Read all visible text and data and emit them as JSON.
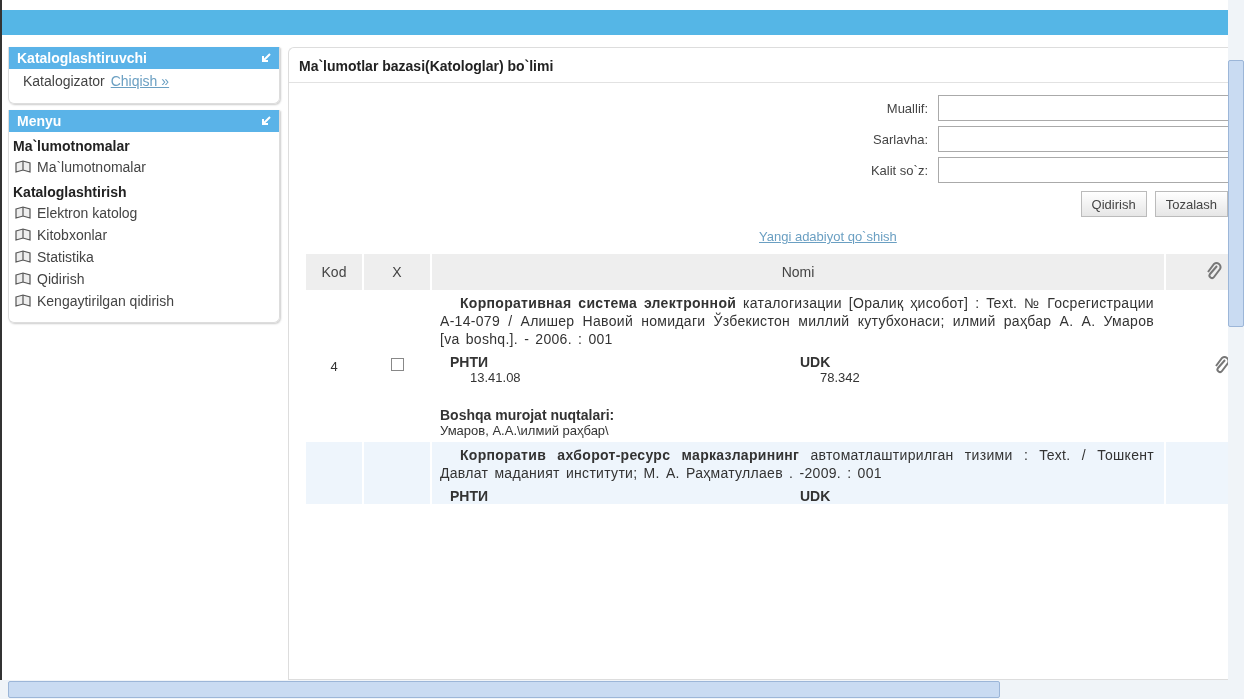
{
  "sidebar": {
    "user_panel": {
      "title": "Kataloglashtiruvchi",
      "user": "Katalogizator",
      "logout": "Chiqish »"
    },
    "menu_panel": {
      "title": "Menyu",
      "groups": [
        {
          "heading": "Ma`lumotnomalar",
          "items": [
            {
              "label": "Ma`lumotnomalar"
            }
          ]
        },
        {
          "heading": "Kataloglashtirish",
          "items": [
            {
              "label": "Elektron katolog"
            },
            {
              "label": "Kitobxonlar"
            },
            {
              "label": "Statistika"
            },
            {
              "label": "Qidirish"
            },
            {
              "label": "Kengaytirilgan qidirish"
            }
          ]
        }
      ]
    }
  },
  "main": {
    "title": "Ma`lumotlar bazasi(Katologlar) bo`limi",
    "search_fields": [
      {
        "label": "Muallif:"
      },
      {
        "label": "Sarlavha:"
      },
      {
        "label": "Kalit so`z:"
      }
    ],
    "buttons": [
      "Qidirish",
      "Tozalash"
    ],
    "add_link": "Yangi adabiyot qo`shish",
    "table": {
      "columns": [
        "Kod",
        "X",
        "Nomi"
      ],
      "rows": [
        {
          "kod": "4",
          "checked": false,
          "selected": false,
          "description": "**Корпоративная система электронной** каталогизации [Оралиқ ҳисобот] : Text. № Госрегистрации А-14-079 / Алишер Навоий номидаги Ўзбекистон миллий кутубхонаси; илмий раҳбар А. А. Умаров [va boshq.]. - 2006. : 001",
          "rnti_label": "РНТИ",
          "rnti_value": "13.41.08",
          "udk_label": "UDK",
          "udk_value": "78.342",
          "other_label": "Boshqa murojat nuqtalari:",
          "other_value": "Умаров, А.А.\\илмий раҳбар\\"
        },
        {
          "selected": true,
          "description": "**Корпоратив ахборот-ресурс марказларининг** автоматлаштирилган тизими : Text. / Тошкент Давлат маданият институти; М. А. Раҳматуллаев . -2009. : 001",
          "rnti_label": "РНТИ",
          "udk_label": "UDK"
        }
      ]
    }
  }
}
